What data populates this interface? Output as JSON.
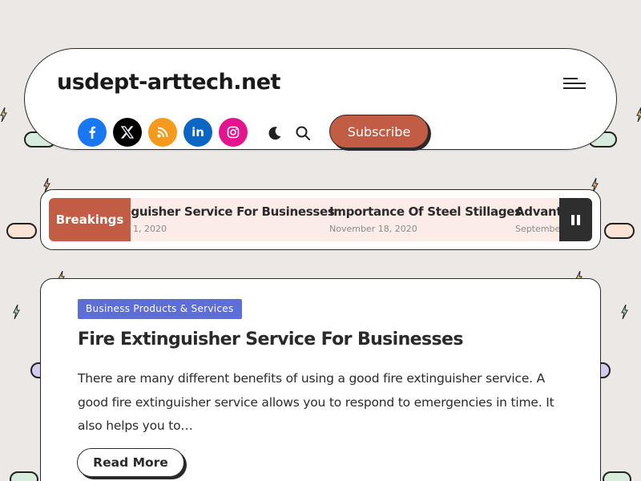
{
  "site": {
    "title": "usdept-arttech.net"
  },
  "header": {
    "socials": [
      {
        "name": "facebook",
        "icon": "facebook-icon",
        "color": "#1877f2"
      },
      {
        "name": "x",
        "icon": "x-icon",
        "color": "#000000"
      },
      {
        "name": "rss",
        "icon": "rss-icon",
        "color": "#f59a1c"
      },
      {
        "name": "linkedin",
        "icon": "linkedin-icon",
        "color": "#0a66c2"
      },
      {
        "name": "instagram",
        "icon": "instagram-icon",
        "color": "#e4148f"
      }
    ],
    "subscribe_label": "Subscribe"
  },
  "ticker": {
    "label": "Breakings",
    "items": [
      {
        "title": "nguisher Service For Businesses",
        "date": "1, 2020"
      },
      {
        "title": "Importance Of Steel Stillages",
        "date": "November 18, 2020"
      },
      {
        "title": "Advanta",
        "date": "September"
      }
    ]
  },
  "post": {
    "category": "Business Products & Services",
    "title": "Fire Extinguisher Service For Businesses",
    "excerpt": "There are many different benefits of using a good fire extinguisher service. A good fire extinguisher service allows you to respond to emergencies in time. It also helps you to…",
    "read_more": "Read More"
  },
  "colors": {
    "accent": "#c25c45",
    "category_bg": "#5e6ed9",
    "ticker_bg": "#fbece8",
    "page_bg": "#ebe8e6"
  }
}
